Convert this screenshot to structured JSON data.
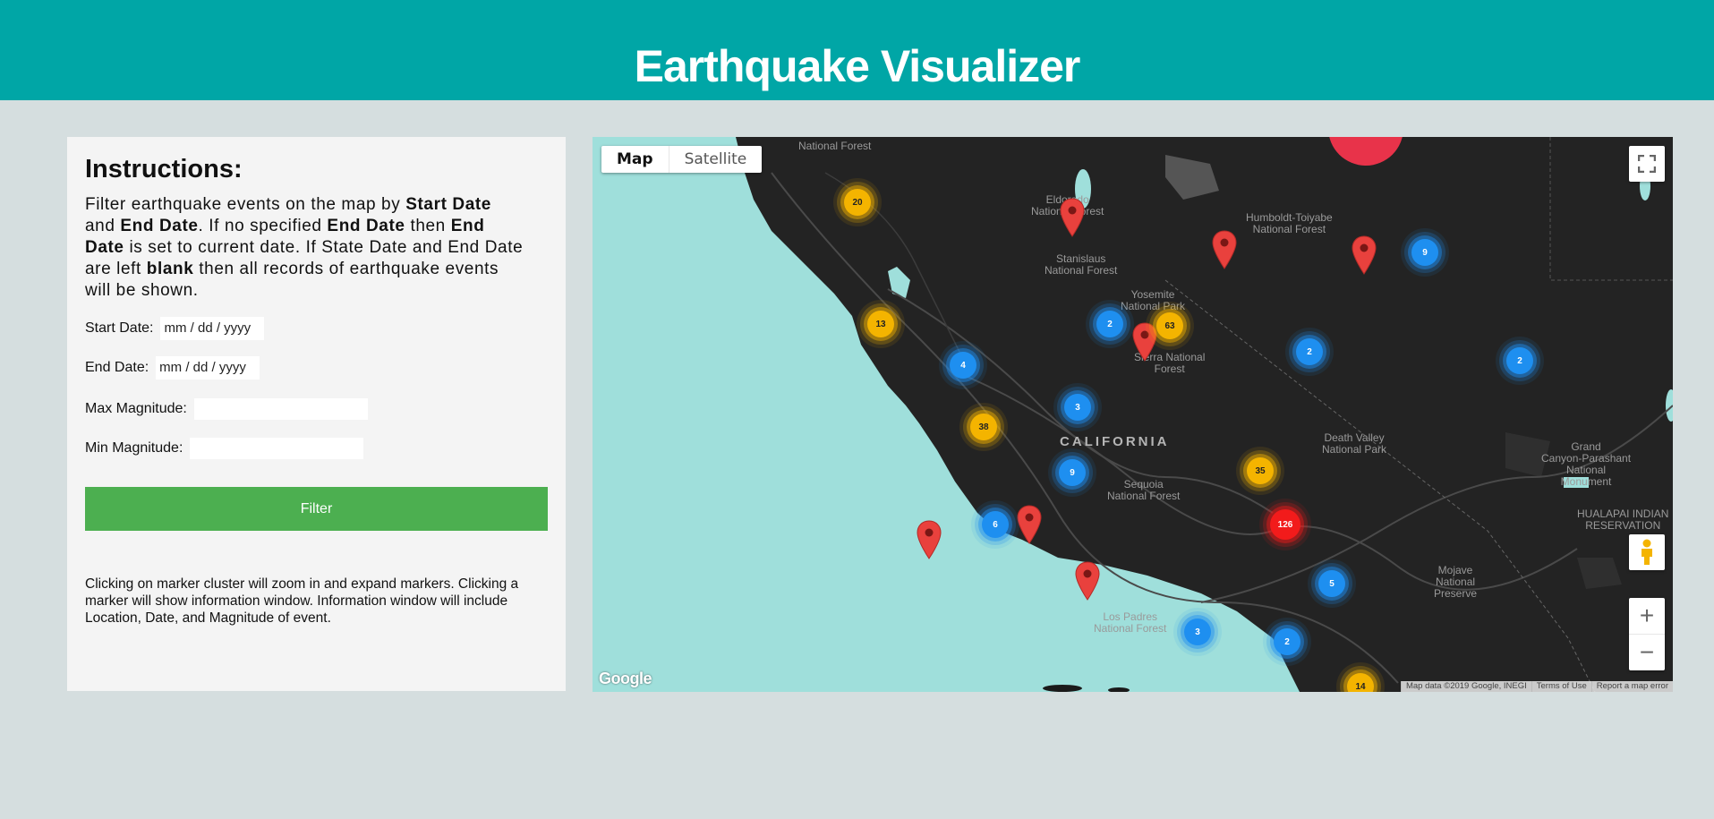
{
  "header": {
    "title": "Earthquake Visualizer"
  },
  "panel": {
    "heading": "Instructions:",
    "instructions": [
      {
        "text": "Filter earthquake events on the map by ",
        "bold": false
      },
      {
        "text": "Start Date",
        "bold": true
      },
      {
        "text": " and ",
        "bold": false
      },
      {
        "text": "End Date",
        "bold": true
      },
      {
        "text": ". If no specified ",
        "bold": false
      },
      {
        "text": "End Date",
        "bold": true
      },
      {
        "text": " then ",
        "bold": false
      },
      {
        "text": "End Date",
        "bold": true
      },
      {
        "text": " is set to current date. If State Date and End Date are left ",
        "bold": false
      },
      {
        "text": "blank",
        "bold": true
      },
      {
        "text": " then all records of earthquake events will be shown.",
        "bold": false
      }
    ],
    "start_date": {
      "label": "Start Date:",
      "placeholder": "mm / dd / yyyy"
    },
    "end_date": {
      "label": "End Date:",
      "placeholder": "mm / dd / yyyy"
    },
    "max_mag": {
      "label": "Max Magnitude:",
      "value": ""
    },
    "min_mag": {
      "label": "Min Magnitude:",
      "value": ""
    },
    "filter_button": "Filter",
    "note": "Clicking on marker cluster will zoom in and expand markers. Clicking a marker will show information window. Information window will include Location, Date, and Magnitude of event."
  },
  "map": {
    "type_map": "Map",
    "type_satellite": "Satellite",
    "state_label": "CALIFORNIA",
    "labels": [
      {
        "id": "national-forest-top",
        "text": "National Forest"
      },
      {
        "id": "eldorado",
        "text": "Eldorado\nNational Forest"
      },
      {
        "id": "humboldt",
        "text": "Humboldt-Toiyabe\nNational Forest"
      },
      {
        "id": "stanislaus",
        "text": "Stanislaus\nNational Forest"
      },
      {
        "id": "yosemite",
        "text": "Yosemite\nNational Park"
      },
      {
        "id": "sierra",
        "text": "Sierra National\nForest"
      },
      {
        "id": "death-valley",
        "text": "Death Valley\nNational Park"
      },
      {
        "id": "sequoia",
        "text": "Sequoia\nNational Forest"
      },
      {
        "id": "grand-canyon",
        "text": "Grand\nCanyon-Parashant\nNational\nMonument"
      },
      {
        "id": "hualapai",
        "text": "HUALAPAI INDIAN\nRESERVATION"
      },
      {
        "id": "mojave",
        "text": "Mojave\nNational\nPreserve"
      },
      {
        "id": "los-padres",
        "text": "Los Padres\nNational Forest"
      }
    ],
    "clusters": [
      {
        "count": "20",
        "level": "yellow"
      },
      {
        "count": "13",
        "level": "yellow"
      },
      {
        "count": "63",
        "level": "yellow"
      },
      {
        "count": "38",
        "level": "yellow"
      },
      {
        "count": "35",
        "level": "yellow"
      },
      {
        "count": "14",
        "level": "yellow"
      },
      {
        "count": "2",
        "level": "blue"
      },
      {
        "count": "2",
        "level": "blue"
      },
      {
        "count": "2",
        "level": "blue"
      },
      {
        "count": "9",
        "level": "blue"
      },
      {
        "count": "4",
        "level": "blue"
      },
      {
        "count": "3",
        "level": "blue"
      },
      {
        "count": "9",
        "level": "blue"
      },
      {
        "count": "6",
        "level": "blue"
      },
      {
        "count": "5",
        "level": "blue"
      },
      {
        "count": "3",
        "level": "blue"
      },
      {
        "count": "2",
        "level": "blue"
      },
      {
        "count": "126",
        "level": "red"
      }
    ],
    "google_logo": "Google",
    "attribution": [
      "Map data ©2019 Google, INEGI",
      "Terms of Use",
      "Report a map error"
    ],
    "colors": {
      "header": "#00a6a6",
      "filter": "#4caf50",
      "water": "#9fdfdb",
      "land": "#232323"
    }
  }
}
